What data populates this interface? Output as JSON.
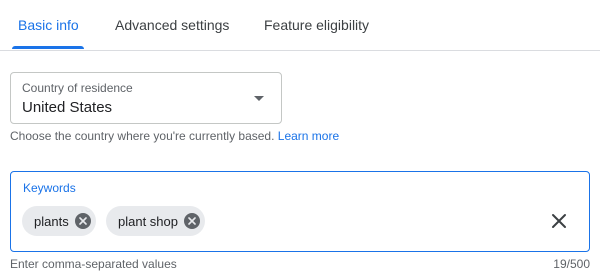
{
  "tabs": [
    {
      "label": "Basic info",
      "active": true
    },
    {
      "label": "Advanced settings",
      "active": false
    },
    {
      "label": "Feature eligibility",
      "active": false
    }
  ],
  "country": {
    "label": "Country of residence",
    "value": "United States",
    "helper_text": "Choose the country where you're currently based.",
    "learn_more": "Learn more",
    "icon": "dropdown-arrow-icon"
  },
  "keywords": {
    "label": "Keywords",
    "chips": [
      {
        "label": "plants",
        "icon": "remove-chip-icon"
      },
      {
        "label": "plant shop",
        "icon": "remove-chip-icon"
      }
    ],
    "clear_icon": "close-icon",
    "helper_text": "Enter comma-separated values",
    "counter": "19/500"
  },
  "colors": {
    "accent": "#1a73e8",
    "text": "#202124",
    "secondary_text": "#5f6368",
    "chip_bg": "#e8eaed",
    "divider": "#dadce0"
  }
}
